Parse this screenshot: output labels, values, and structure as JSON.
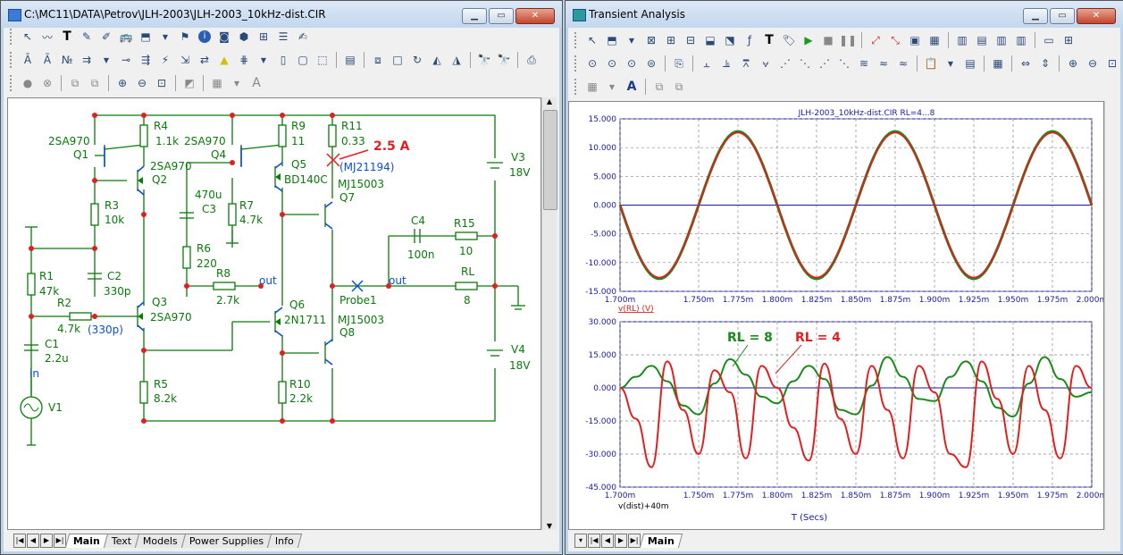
{
  "schematic_window": {
    "title": "C:\\MC11\\DATA\\Petrov\\JLH-2003\\JLH-2003_10kHz-dist.CIR",
    "tabs": [
      "Main",
      "Text",
      "Models",
      "Power Supplies",
      "Info"
    ],
    "active_tab": "Main"
  },
  "schematic": {
    "components": {
      "q1": {
        "name": "Q1",
        "model": "2SA970"
      },
      "q2": {
        "name": "Q2",
        "model": "2SA970"
      },
      "q3": {
        "name": "Q3",
        "model": "2SA970"
      },
      "q4": {
        "name": "Q4",
        "model": "2SA970"
      },
      "q5": {
        "name": "Q5",
        "model": "BD140C"
      },
      "q6": {
        "name": "Q6",
        "model": "2N1711"
      },
      "q7": {
        "name": "Q7",
        "model": "MJ15003"
      },
      "q8": {
        "name": "Q8",
        "model": "MJ15003"
      },
      "r1": {
        "name": "R1",
        "value": "47k"
      },
      "r2": {
        "name": "R2",
        "value": "4.7k"
      },
      "r3": {
        "name": "R3",
        "value": "10k"
      },
      "r4": {
        "name": "R4",
        "value": "1.1k"
      },
      "r5": {
        "name": "R5",
        "value": "8.2k"
      },
      "r6": {
        "name": "R6",
        "value": "220"
      },
      "r7": {
        "name": "R7",
        "value": "4.7k"
      },
      "r8": {
        "name": "R8",
        "value": "2.7k"
      },
      "r9": {
        "name": "R9",
        "value": "11"
      },
      "r10": {
        "name": "R10",
        "value": "2.2k"
      },
      "r11": {
        "name": "R11",
        "value": "0.33"
      },
      "r15": {
        "name": "R15",
        "value": "10"
      },
      "rl": {
        "name": "RL",
        "value": "8"
      },
      "c1": {
        "name": "C1",
        "value": "2.2u"
      },
      "c2": {
        "name": "C2",
        "value": "330p"
      },
      "c3": {
        "name": "C3",
        "value": "470u"
      },
      "c4": {
        "name": "C4",
        "value": "100n"
      },
      "v1": {
        "name": "V1"
      },
      "v3": {
        "name": "V3",
        "value": "18V"
      },
      "v4": {
        "name": "V4",
        "value": "18V"
      }
    },
    "annotations": {
      "current": "2.5 A",
      "part_note": "(MJ21194)",
      "c2_note": "(330p)",
      "out_label": "out",
      "in_label": "in",
      "probe": "Probe1"
    }
  },
  "analysis_window": {
    "title": "Transient Analysis",
    "tabs": [
      "Main"
    ],
    "active_tab": "Main",
    "plot_title": "JLH-2003_10kHz-dist.CIR RL=4...8",
    "xlabel": "T (Secs)",
    "x_ticks": [
      "1.700m",
      "1.750m",
      "1.775m",
      "1.800m",
      "1.825m",
      "1.850m",
      "1.875m",
      "1.900m",
      "1.925m",
      "1.950m",
      "1.975m",
      "2.000m"
    ],
    "colors": {
      "green": "#1a8a1a",
      "red": "#e02020",
      "axis_text": "#1a1aa0"
    }
  },
  "chart_data": [
    {
      "type": "line",
      "ylabel": "v(RL) (V)",
      "xlim": [
        0.0017,
        0.002
      ],
      "ylim": [
        -15,
        15
      ],
      "y_ticks": [
        "15.000",
        "10.000",
        "5.000",
        "0.000",
        "-5.000",
        "-10.000",
        "-15.000"
      ],
      "grid": true,
      "series": [
        {
          "name": "RL = 8",
          "color": "#1a8a1a",
          "frequency_hz": 10000,
          "amplitude": 12.8,
          "phase_deg": 180
        },
        {
          "name": "RL = 4",
          "color": "#e02020",
          "frequency_hz": 10000,
          "amplitude": 12.6,
          "phase_deg": 180
        }
      ]
    },
    {
      "type": "line",
      "ylabel": "v(dist)+40m",
      "xlim": [
        0.0017,
        0.002
      ],
      "ylim": [
        -45,
        30
      ],
      "y_ticks": [
        "30.000",
        "15.000",
        "0.000",
        "-15.000",
        "-30.000",
        "-45.000"
      ],
      "grid": true,
      "legend": [
        "RL = 8",
        "RL = 4"
      ],
      "series": [
        {
          "name": "RL = 8",
          "color": "#1a8a1a",
          "x": [
            0.0017,
            0.00171,
            0.00172,
            0.00173,
            0.00174,
            0.00175,
            0.00176,
            0.00177,
            0.00178,
            0.00179,
            0.0018,
            0.00181,
            0.00182,
            0.00183,
            0.00184,
            0.00185,
            0.00186,
            0.00187,
            0.00188,
            0.00189,
            0.0019,
            0.00191,
            0.00192,
            0.00193,
            0.00194,
            0.00195,
            0.00196,
            0.00197,
            0.00198,
            0.00199,
            0.002
          ],
          "y": [
            0,
            5,
            10,
            3,
            -8,
            -12,
            2,
            13,
            6,
            -4,
            -7,
            3,
            10,
            4,
            -10,
            -12,
            1,
            14,
            5,
            -5,
            -6,
            5,
            12,
            3,
            -9,
            -13,
            2,
            14,
            4,
            -4,
            -2
          ]
        },
        {
          "name": "RL = 4",
          "color": "#e02020",
          "x": [
            0.0017,
            0.00171,
            0.00172,
            0.00173,
            0.00174,
            0.00175,
            0.00176,
            0.00177,
            0.00178,
            0.00179,
            0.0018,
            0.00181,
            0.00182,
            0.00183,
            0.00184,
            0.00185,
            0.00186,
            0.00187,
            0.00188,
            0.00189,
            0.0019,
            0.00191,
            0.00192,
            0.00193,
            0.00194,
            0.00195,
            0.00196,
            0.00197,
            0.00198,
            0.00199,
            0.002
          ],
          "y": [
            0,
            -14,
            -36,
            12,
            -10,
            -30,
            8,
            -2,
            -32,
            10,
            0,
            -18,
            -33,
            11,
            -14,
            -30,
            10,
            -10,
            -32,
            10,
            -2,
            -30,
            -36,
            12,
            -5,
            -30,
            10,
            -10,
            -32,
            10,
            0
          ]
        }
      ]
    }
  ]
}
